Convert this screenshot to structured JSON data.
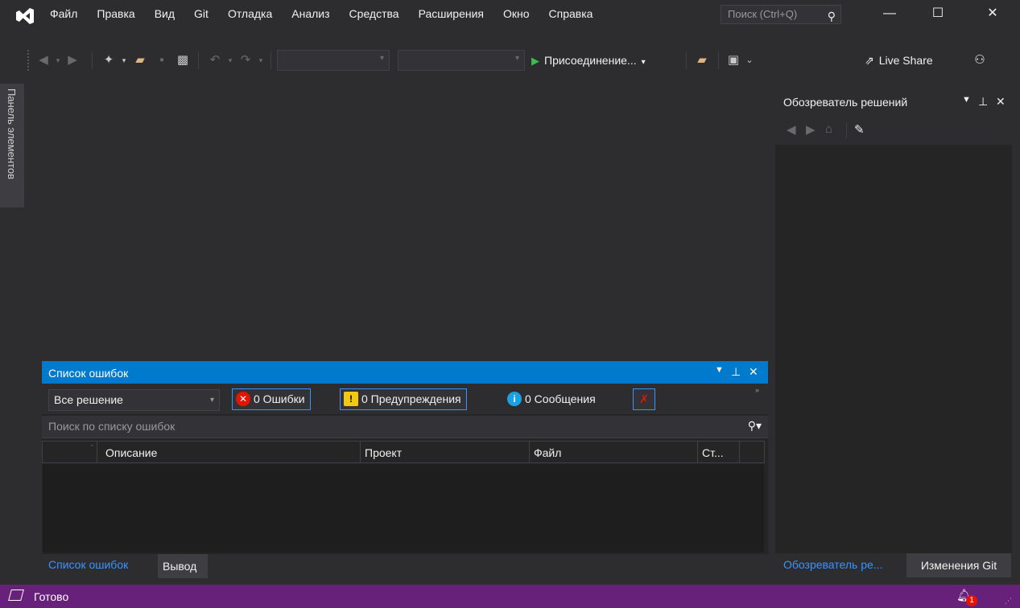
{
  "app": {
    "menu_items": [
      "Файл",
      "Правка",
      "Вид",
      "Git",
      "Отладка",
      "Анализ",
      "Средства",
      "Расширения",
      "Окно",
      "Справка"
    ],
    "search_placeholder": "Поиск (Ctrl+Q)",
    "window_controls": {
      "minimize": "—",
      "maximize": "☐",
      "close": "✕"
    }
  },
  "toolbar": {
    "attach_label": "Присоединение...",
    "live_share_label": "Live Share",
    "icons": [
      "back-icon",
      "forward-icon",
      "new-project-icon",
      "open-folder-icon",
      "save-icon",
      "save-all-icon",
      "undo-icon",
      "redo-icon",
      "find-folder-icon",
      "browser-link-icon",
      "feedback-icon"
    ]
  },
  "toolbox_tab": {
    "label": "Панель элементов"
  },
  "solution_explorer": {
    "title": "Обозреватель решений",
    "tabs": [
      "Обозреватель ре...",
      "Изменения Git"
    ]
  },
  "error_list": {
    "title": "Список ошибок",
    "scope": "Все решение",
    "errors_label": "0 Ошибки",
    "warnings_label": "0 Предупреждения",
    "messages_label": "0 Сообщения",
    "search_placeholder": "Поиск по списку ошибок",
    "columns": [
      "Описание",
      "Проект",
      "Файл",
      "Ст..."
    ],
    "tabs": [
      "Список ошибок",
      "Вывод"
    ]
  },
  "status_bar": {
    "text": "Готово",
    "notification_count": "1"
  },
  "colors": {
    "accent": "#007acc",
    "status_bar": "#68217a",
    "link": "#3794ff"
  }
}
